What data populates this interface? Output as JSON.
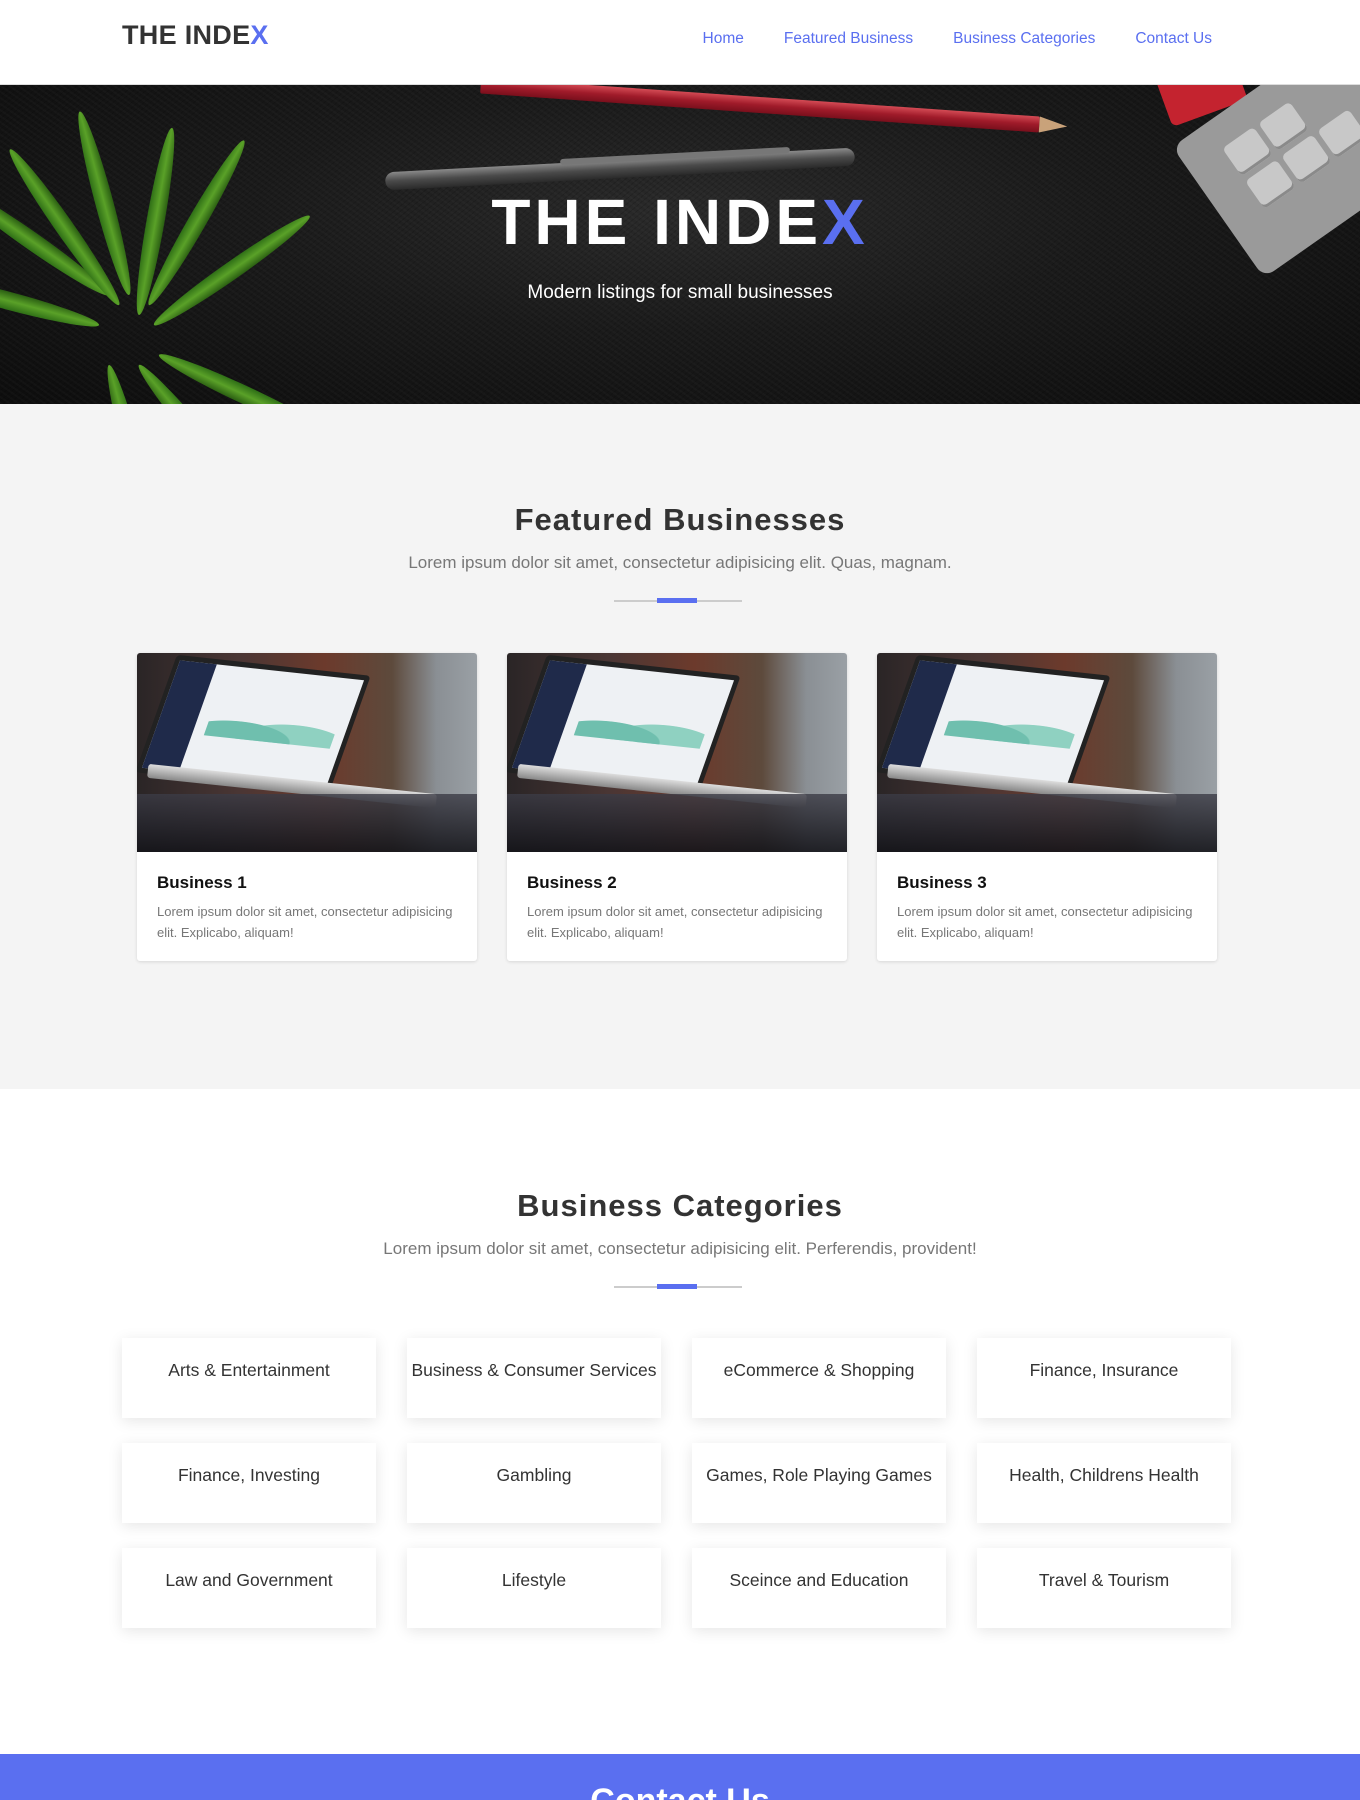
{
  "brand": {
    "text_main": "THE INDE",
    "text_accent": "X"
  },
  "nav": {
    "home": "Home",
    "featured": "Featured Business",
    "categories": "Business Categories",
    "contact": "Contact Us"
  },
  "hero": {
    "title_main": "THE INDE",
    "title_accent": "X",
    "subtitle": "Modern listings for small businesses"
  },
  "featured": {
    "title": "Featured Businesses",
    "subtitle": "Lorem ipsum dolor sit amet, consectetur adipisicing elit. Quas, magnam.",
    "cards": [
      {
        "title": "Business 1",
        "text": "Lorem ipsum dolor sit amet, consectetur adipisicing elit. Explicabo, aliquam!"
      },
      {
        "title": "Business 2",
        "text": "Lorem ipsum dolor sit amet, consectetur adipisicing elit. Explicabo, aliquam!"
      },
      {
        "title": "Business 3",
        "text": "Lorem ipsum dolor sit amet, consectetur adipisicing elit. Explicabo, aliquam!"
      }
    ]
  },
  "categories": {
    "title": "Business Categories",
    "subtitle": "Lorem ipsum dolor sit amet, consectetur adipisicing elit. Perferendis, provident!",
    "items": [
      "Arts & Entertainment",
      "Business & Consumer Services",
      "eCommerce & Shopping",
      "Finance, Insurance",
      "Finance, Investing",
      "Gambling",
      "Games, Role Playing Games",
      "Health, Childrens Health",
      "Law and Government",
      "Lifestyle",
      "Sceince and Education",
      "Travel & Tourism"
    ]
  },
  "contact": {
    "title": "Contact Us"
  },
  "colors": {
    "accent": "#5a6ff0",
    "section_bg": "#f4f4f4"
  }
}
